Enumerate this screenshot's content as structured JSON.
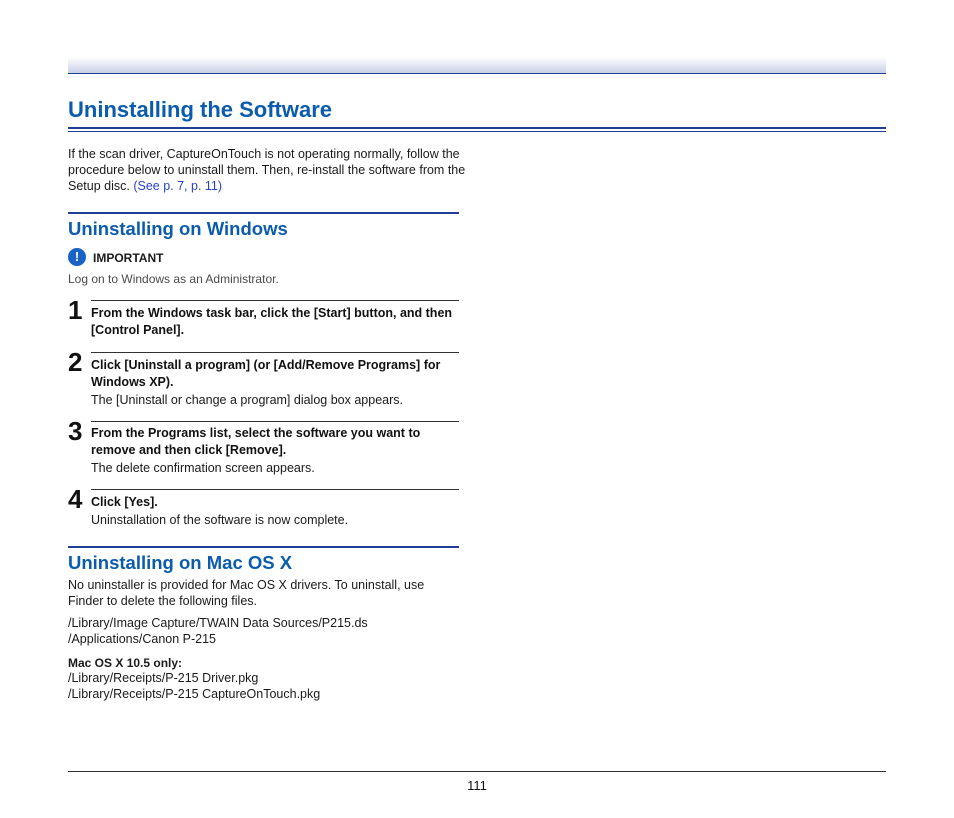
{
  "page": {
    "title": "Uninstalling the Software",
    "intro": {
      "text": "If the scan driver, CaptureOnTouch is not operating normally, follow the procedure below to uninstall them. Then, re-install the software from the Setup disc.",
      "link": "(See p. 7, p. 11)"
    },
    "number": "111"
  },
  "windows": {
    "title": "Uninstalling on Windows",
    "important_icon": "exclamation-circle-icon",
    "important_label": "IMPORTANT",
    "important_text": "Log on to Windows as an Administrator.",
    "steps": [
      {
        "number": "1",
        "text": "From the Windows task bar, click the [Start] button, and then [Control Panel].",
        "sub": ""
      },
      {
        "number": "2",
        "text": "Click [Uninstall a program] (or [Add/Remove Programs] for Windows XP).",
        "sub": "The [Uninstall or change a program] dialog box appears."
      },
      {
        "number": "3",
        "text": "From the Programs list, select the software you want to remove and then click [Remove].",
        "sub": "The delete confirmation screen appears."
      },
      {
        "number": "4",
        "text": "Click [Yes].",
        "sub": "Uninstallation of the software is now complete."
      }
    ]
  },
  "mac": {
    "title": "Uninstalling on Mac OS X",
    "intro": "No uninstaller is provided for Mac OS X drivers. To uninstall, use Finder to delete the following files.",
    "paths": [
      "/Library/Image Capture/TWAIN Data Sources/P215.ds",
      "/Applications/Canon P-215"
    ],
    "only_heading": "Mac OS X 10.5 only:",
    "only_paths": [
      "/Library/Receipts/P-215 Driver.pkg",
      "/Library/Receipts/P-215 CaptureOnTouch.pkg"
    ]
  },
  "colors": {
    "heading_blue": "#0b5cad",
    "rule_navy": "#1f3f95",
    "link_blue": "#2a41c7",
    "icon_blue": "#1a63c6"
  }
}
